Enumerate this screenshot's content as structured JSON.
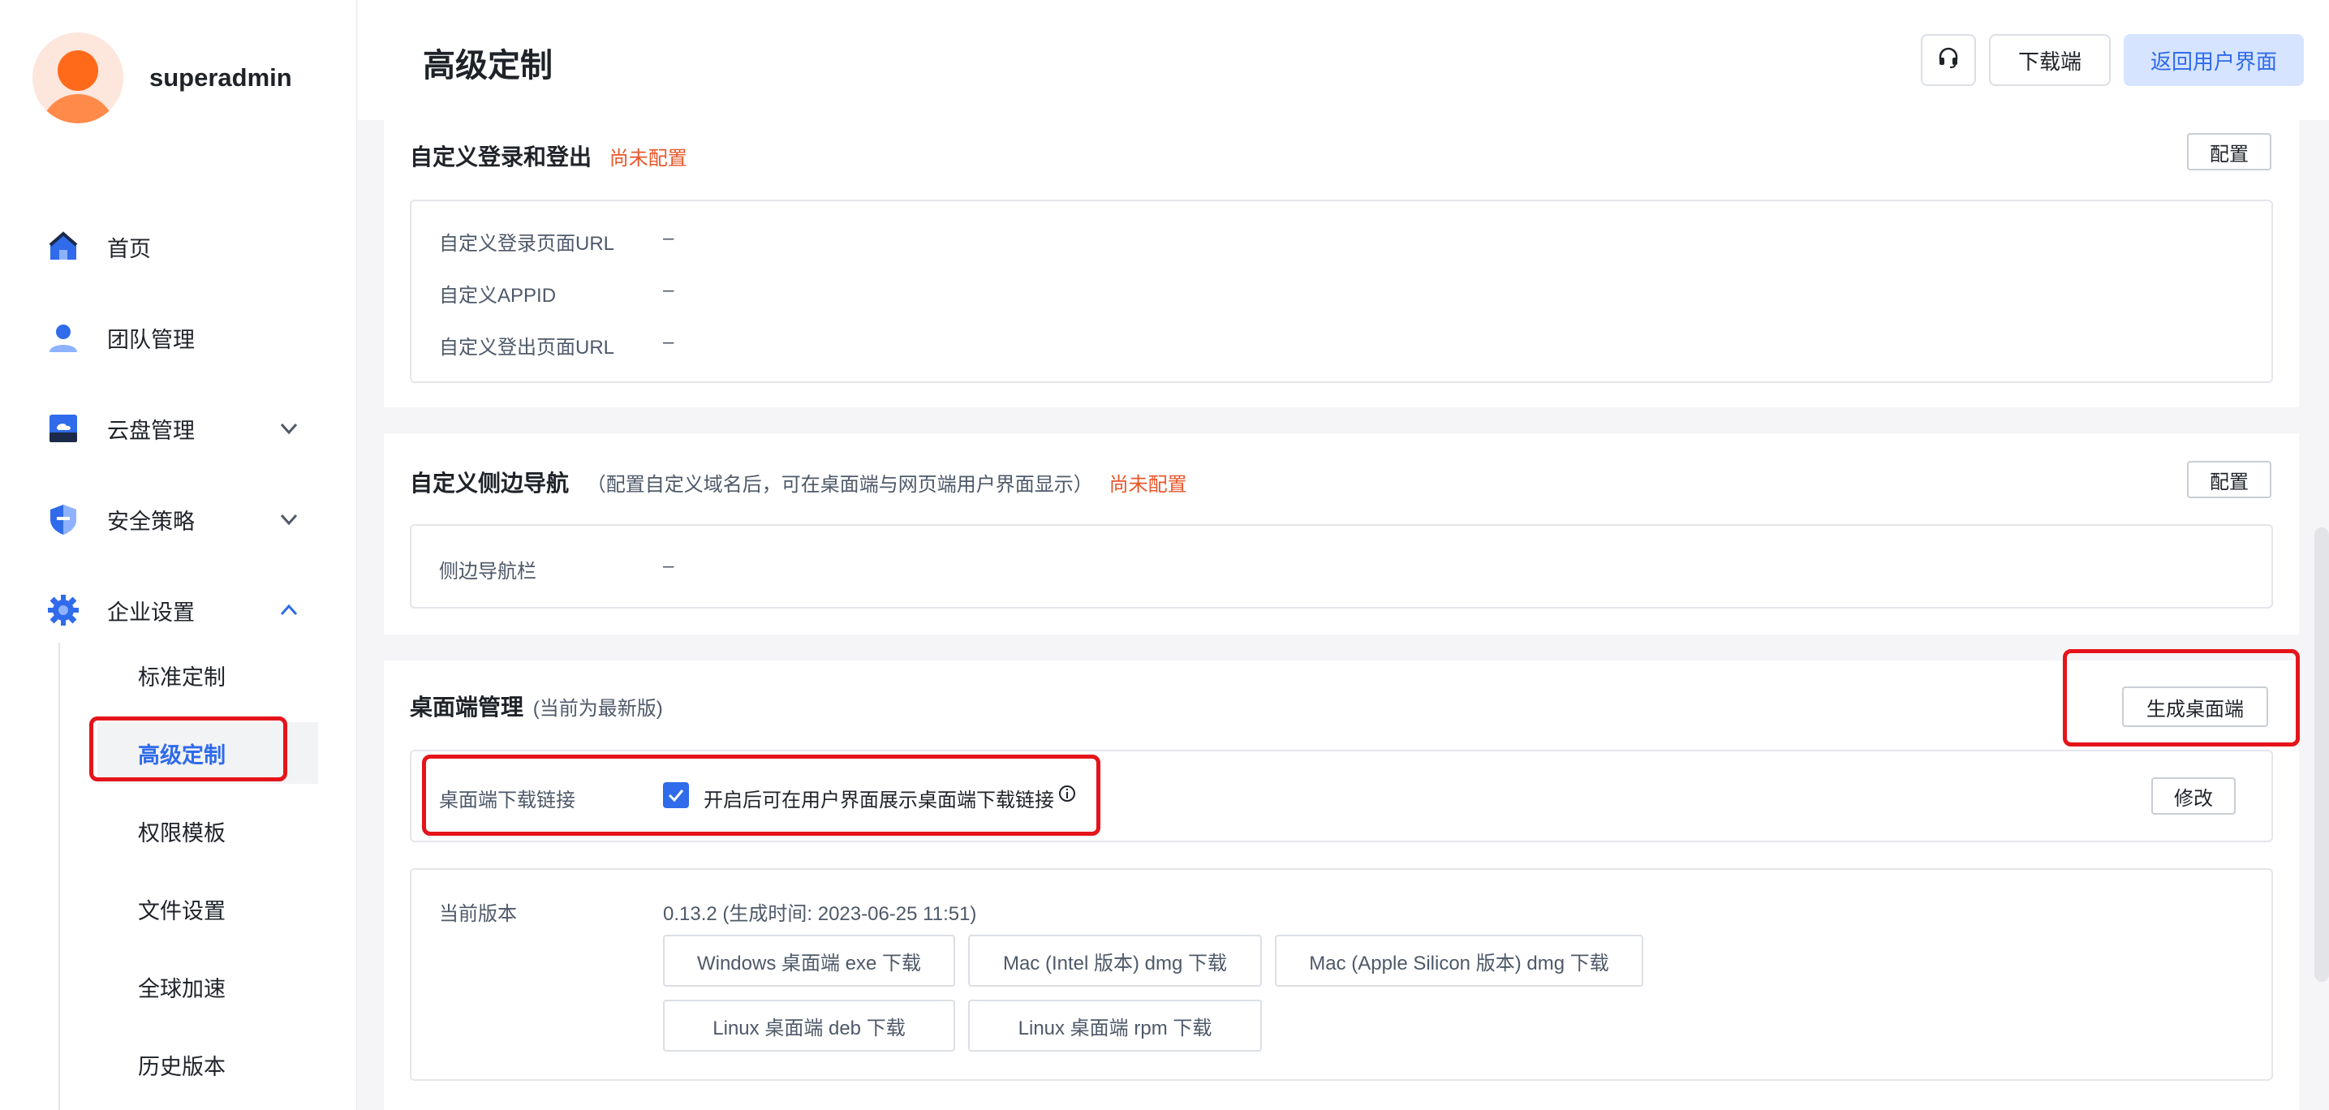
{
  "user": {
    "name": "superadmin"
  },
  "sidebar": {
    "items": [
      {
        "label": "首页",
        "icon": "home-icon"
      },
      {
        "label": "团队管理",
        "icon": "team-icon"
      },
      {
        "label": "云盘管理",
        "icon": "cloud-drive-icon",
        "expandable": true,
        "expanded": false
      },
      {
        "label": "安全策略",
        "icon": "shield-icon",
        "expandable": true,
        "expanded": false
      },
      {
        "label": "企业设置",
        "icon": "gear-icon",
        "expandable": true,
        "expanded": true
      }
    ],
    "sub_items": [
      "标准定制",
      "高级定制",
      "权限模板",
      "文件设置",
      "全球加速",
      "历史版本"
    ],
    "active_sub_item": "高级定制"
  },
  "header": {
    "title": "高级定制",
    "support_icon": "headset-icon",
    "download_label": "下载端",
    "back_label": "返回用户界面"
  },
  "login_panel": {
    "title": "自定义登录和登出",
    "status": "尚未配置",
    "config_label": "配置",
    "fields": [
      {
        "key": "自定义登录页面URL",
        "value": "–"
      },
      {
        "key": "自定义APPID",
        "value": "–"
      },
      {
        "key": "自定义登出页面URL",
        "value": "–"
      }
    ]
  },
  "sidenav_panel": {
    "title": "自定义侧边导航",
    "subtitle": "（配置自定义域名后，可在桌面端与网页端用户界面显示）",
    "status": "尚未配置",
    "config_label": "配置",
    "fields": [
      {
        "key": "侧边导航栏",
        "value": "–"
      }
    ]
  },
  "desktop_panel": {
    "title": "桌面端管理",
    "subtitle": "(当前为最新版)",
    "generate_label": "生成桌面端",
    "link_key": "桌面端下载链接",
    "link_checkbox_checked": true,
    "link_checkbox_label": "开启后可在用户界面展示桌面端下载链接",
    "modify_label": "修改",
    "version_key": "当前版本",
    "version_value": "0.13.2 (生成时间: 2023-06-25 11:51)",
    "downloads": [
      "Windows 桌面端 exe 下载",
      "Mac (Intel 版本) dmg 下载",
      "Mac (Apple Silicon 版本) dmg 下载",
      "Linux 桌面端 deb 下载",
      "Linux 桌面端 rpm 下载"
    ]
  },
  "colors": {
    "accent": "#2f6bea",
    "warning": "#e8572a",
    "highlight": "#e5141a"
  }
}
